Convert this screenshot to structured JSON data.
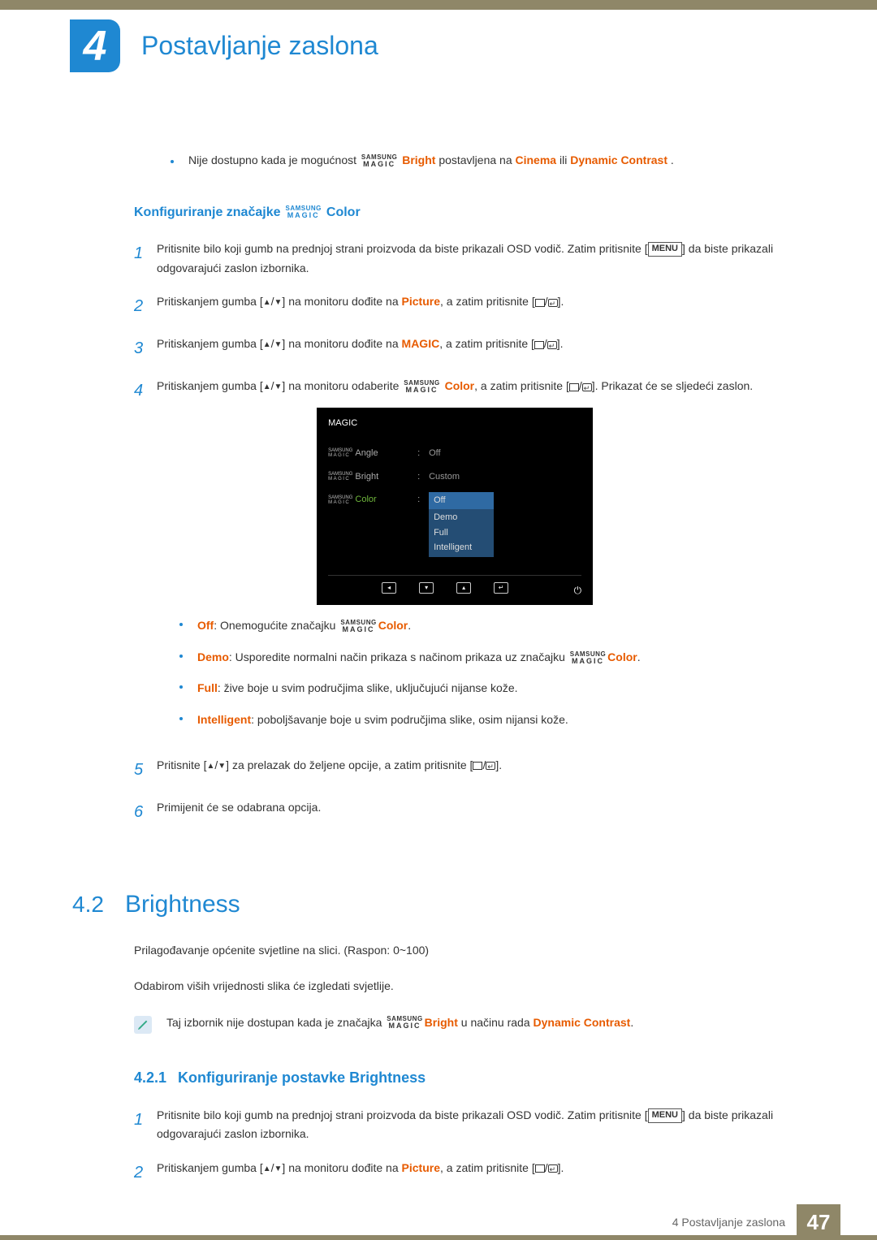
{
  "chapter": {
    "number": "4",
    "title": "Postavljanje zaslona"
  },
  "topNote": {
    "pre": "Nije dostupno kada je mogućnost ",
    "brightWord": "Bright",
    "mid": " postavljena na ",
    "cinema": "Cinema",
    "or": " ili ",
    "dc": "Dynamic Contrast",
    "end": "."
  },
  "subheading1": {
    "pre": "Konfiguriranje značajke ",
    "suffix": "Color"
  },
  "steps1": {
    "s1a": "Pritisnite bilo koji gumb na prednjoj strani proizvoda da biste prikazali OSD vodič. Zatim pritisnite [",
    "menu": "MENU",
    "s1b": "] da biste prikazali odgovarajući zaslon izbornika.",
    "s2a": "Pritiskanjem gumba [",
    "s2b": "] na monitoru dođite na ",
    "picture": "Picture",
    "s2c": ", a zatim pritisnite [",
    "s2d": "].",
    "s3a": "Pritiskanjem gumba [",
    "s3b": "] na monitoru dođite na ",
    "magic": "MAGIC",
    "s3c": ", a zatim pritisnite [",
    "s3d": "].",
    "s4a": "Pritiskanjem gumba [",
    "s4b": "] na monitoru odaberite ",
    "colorWord": "Color",
    "s4c": ", a zatim pritisnite [",
    "s4d": "]. Prikazat će se sljedeći zaslon.",
    "s5a": "Pritisnite [",
    "s5b": "] za prelazak do željene opcije, a zatim pritisnite [",
    "s5c": "].",
    "s6": "Primijenit će se odabrana opcija."
  },
  "osd": {
    "title": "MAGIC",
    "rows": {
      "angle": {
        "label": "Angle",
        "value": "Off"
      },
      "bright": {
        "label": "Bright",
        "value": "Custom"
      },
      "color": {
        "label": "Color"
      }
    },
    "options": {
      "off": "Off",
      "demo": "Demo",
      "full": "Full",
      "intelligent": "Intelligent"
    }
  },
  "bullets": {
    "offLabel": "Off",
    "off": ": Onemogućite značajku ",
    "offSuffix": "Color",
    "offEnd": ".",
    "demoLabel": "Demo",
    "demo": ": Usporedite normalni način prikaza s načinom prikaza uz značajku ",
    "demoSuffix": "Color",
    "demoEnd": ".",
    "fullLabel": "Full",
    "full": ": žive boje u svim područjima slike, uključujući nijanse kože.",
    "intLabel": "Intelligent",
    "int": ": poboljšavanje boje u svim područjima slike, osim nijansi kože."
  },
  "section42": {
    "num": "4.2",
    "title": "Brightness",
    "p1": "Prilagođavanje općenite svjetline na slici. (Raspon: 0~100)",
    "p2": "Odabirom viših vrijednosti slika će izgledati svjetlije.",
    "notePre": "Taj izbornik nije dostupan kada je značajka ",
    "noteBright": "Bright",
    "noteMid": " u načinu rada ",
    "noteDC": "Dynamic Contrast",
    "noteEnd": "."
  },
  "sub421": {
    "num": "4.2.1",
    "title": "Konfiguriranje postavke Brightness"
  },
  "steps2": {
    "s1a": "Pritisnite bilo koji gumb na prednjoj strani proizvoda da biste prikazali OSD vodič. Zatim pritisnite [",
    "menu": "MENU",
    "s1b": "] da biste prikazali odgovarajući zaslon izbornika.",
    "s2a": "Pritiskanjem gumba [",
    "s2b": "] na monitoru dođite na ",
    "picture": "Picture",
    "s2c": ", a zatim pritisnite [",
    "s2d": "]."
  },
  "footer": {
    "text": "4 Postavljanje zaslona",
    "page": "47"
  }
}
